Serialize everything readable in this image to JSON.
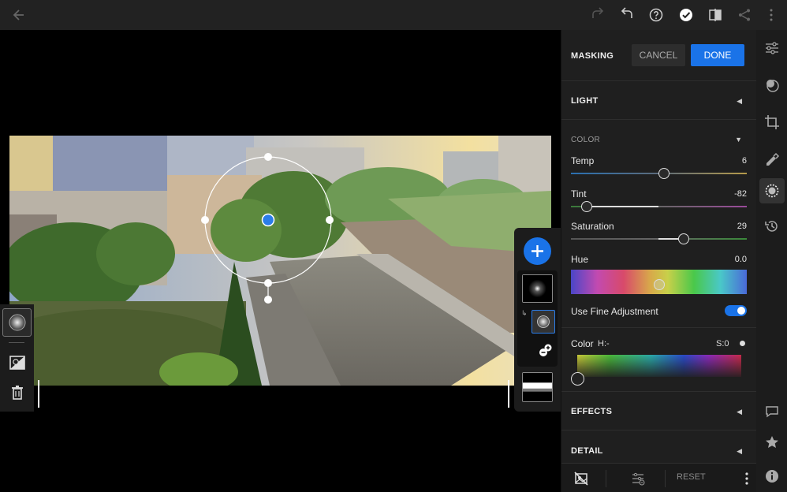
{
  "panel": {
    "masking_title": "MASKING",
    "cancel_label": "CANCEL",
    "done_label": "DONE",
    "sections": {
      "light": "LIGHT",
      "color": "COLOR",
      "effects": "EFFECTS",
      "detail": "DETAIL"
    },
    "temp": {
      "label": "Temp",
      "value": "6",
      "position": 0.53
    },
    "tint": {
      "label": "Tint",
      "value": "-82",
      "position": 0.09
    },
    "saturation": {
      "label": "Saturation",
      "value": "29",
      "position": 0.64
    },
    "hue": {
      "label": "Hue",
      "value": "0.0",
      "position": 0.5
    },
    "fine_adjustment": {
      "label": "Use Fine Adjustment",
      "enabled": true
    },
    "color_picker": {
      "label": "Color",
      "h_label": "H:-",
      "s_label": "S:0"
    },
    "footer": {
      "reset_label": "RESET"
    }
  },
  "colors": {
    "accent": "#1a73e8",
    "panel_bg": "#1f1f1f",
    "topbar_bg": "#222222"
  },
  "icons": {
    "topbar": [
      "back-arrow-icon",
      "redo-icon",
      "undo-icon",
      "help-icon",
      "check-icon",
      "compare-icon",
      "share-icon",
      "more-icon"
    ],
    "rail": [
      "edit-sliders-icon",
      "presets-icon",
      "crop-icon",
      "healing-icon",
      "masking-icon",
      "history-icon",
      "comment-icon",
      "star-icon",
      "info-icon"
    ]
  }
}
